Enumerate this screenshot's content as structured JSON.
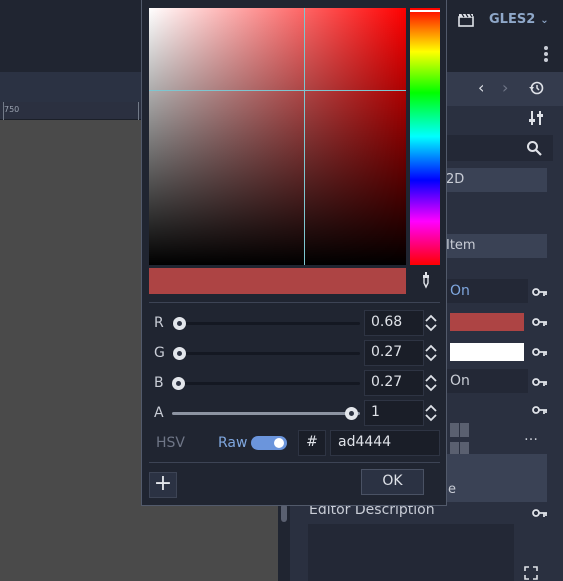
{
  "topbar": {
    "renderer_label": "GLES2"
  },
  "ruler": {
    "mark_label": "750"
  },
  "inspector": {
    "section_1": "2D",
    "section_2": "Item",
    "visible_value": "On",
    "show_behind_value": "On",
    "sub_section": "e",
    "editor_description_label": "Editor Description",
    "modulate_color": "#ad4444",
    "self_modulate_color": "#ffffff",
    "more_label": "…"
  },
  "picker": {
    "current_color": "#ad4444",
    "channels": [
      {
        "label": "R",
        "value": "0.68"
      },
      {
        "label": "G",
        "value": "0.27"
      },
      {
        "label": "B",
        "value": "0.27"
      },
      {
        "label": "A",
        "value": "1"
      }
    ],
    "hsv_label": "HSV",
    "raw_label": "Raw",
    "raw_on": true,
    "hash_label": "#",
    "hex_value": "ad4444",
    "add_label": "+",
    "ok_label": "OK"
  }
}
